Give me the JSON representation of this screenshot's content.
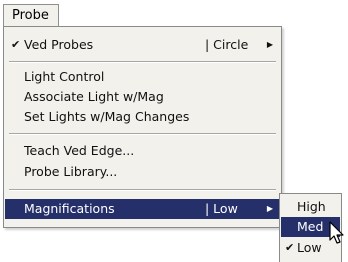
{
  "menubar": {
    "probe_label": "Probe"
  },
  "probe_menu": {
    "ved_probes": {
      "label": "Ved Probes",
      "checked": true,
      "value": "| Circle"
    },
    "light_control": "Light Control",
    "associate_light": "Associate Light w/Mag",
    "set_lights": "Set Lights w/Mag Changes",
    "teach_ved_edge": "Teach Ved Edge...",
    "probe_library": "Probe Library...",
    "magnifications": {
      "label": "Magnifications",
      "value": "| Low"
    }
  },
  "magnifications_submenu": {
    "items": [
      {
        "label": "High",
        "checked": false,
        "highlighted": false
      },
      {
        "label": "Med",
        "checked": false,
        "highlighted": true
      },
      {
        "label": "Low",
        "checked": true,
        "highlighted": false
      }
    ]
  },
  "colors": {
    "highlight": "#25306b",
    "menu_bg": "#f3f1ec"
  },
  "icons": {
    "check": "check-icon",
    "submenu_arrow": "submenu-arrow-icon",
    "cursor": "mouse-pointer-icon"
  }
}
